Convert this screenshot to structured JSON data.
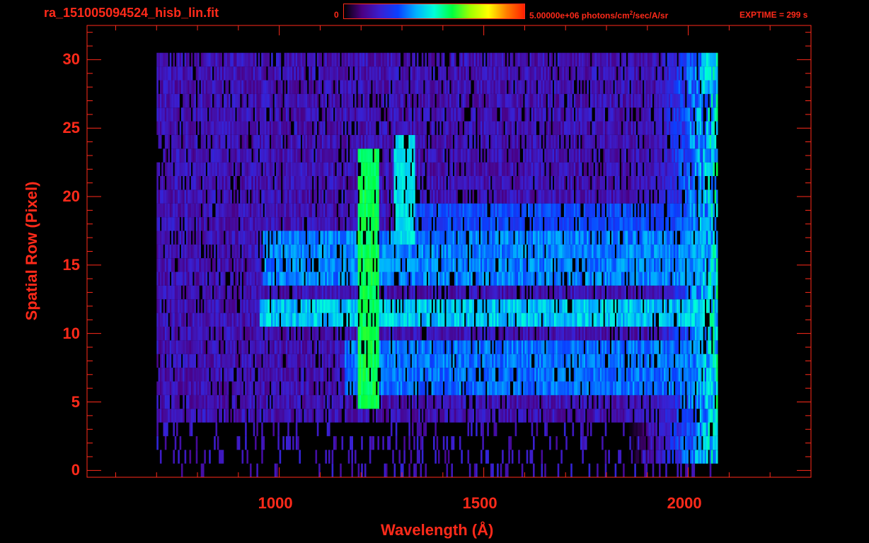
{
  "header": {
    "filename": "ra_151005094524_hisb_lin.fit",
    "colorbar_min": "0",
    "colorbar_max_prefix": "5.00000e+06 photons/cm",
    "colorbar_max_sup": "2",
    "colorbar_max_suffix": "/sec/A/sr",
    "exptime": "EXPTIME = 299 s"
  },
  "colors": {
    "axis": "#ff2a1a",
    "background": "#000000",
    "colormap": [
      "#000000",
      "#4b0082",
      "#3a1fd0",
      "#0a40ff",
      "#00b0ff",
      "#00ffd8",
      "#00ff40",
      "#a0ff00",
      "#ffff00",
      "#ff8000",
      "#ff2000"
    ]
  },
  "chart_data": {
    "type": "heatmap",
    "xlabel": "Wavelength (Å)",
    "ylabel": "Spatial Row (Pixel)",
    "xlim": [
      530,
      2300
    ],
    "ylim": [
      -0.5,
      32.5
    ],
    "xticks": [
      1000,
      1500,
      2000
    ],
    "yticks": [
      0,
      5,
      10,
      15,
      20,
      25,
      30
    ],
    "colorbar_range": [
      0,
      5000000
    ],
    "colorbar_units": "photons/cm^2/sec/A/sr",
    "data_extent": {
      "x": [
        700,
        2070
      ],
      "rows": [
        0,
        30
      ]
    },
    "features": [
      {
        "type": "emission_line",
        "wavelength": 1216,
        "rows": [
          5,
          23
        ],
        "level": 0.55
      },
      {
        "type": "emission_line",
        "wavelength": 1304,
        "rows": [
          17,
          24
        ],
        "level": 0.42
      },
      {
        "type": "continuum_band",
        "rows": [
          6,
          9
        ],
        "x_start": 1160,
        "level": 0.38
      },
      {
        "type": "continuum_band",
        "rows": [
          11,
          12
        ],
        "x_start": 950,
        "level": 0.48
      },
      {
        "type": "continuum_band",
        "rows": [
          14,
          17
        ],
        "x_start": 960,
        "level": 0.4
      },
      {
        "type": "continuum_band",
        "rows": [
          18,
          19
        ],
        "x_start": 1300,
        "level": 0.33
      },
      {
        "type": "edge_rise",
        "x_start": 1850,
        "x_end": 2070,
        "level": 0.55
      }
    ]
  }
}
